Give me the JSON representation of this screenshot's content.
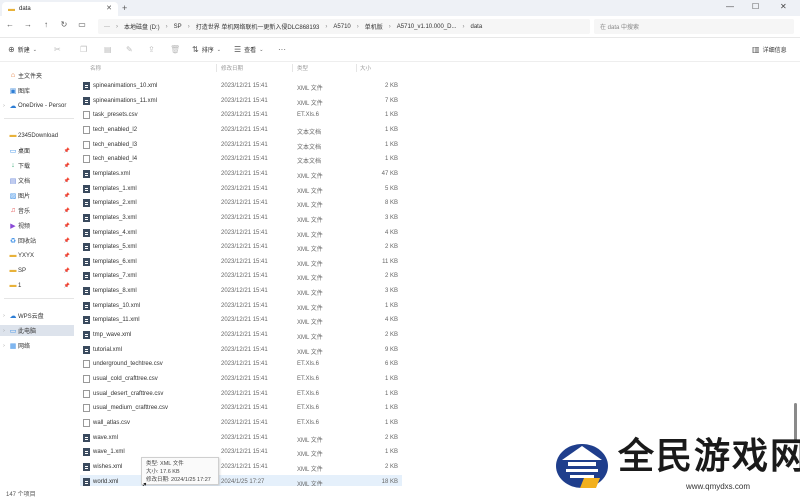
{
  "window": {
    "tab_title": "data",
    "minimize_glyph": "—",
    "maximize_glyph": "☐",
    "close_glyph": "✕"
  },
  "address": {
    "path": [
      "本地磁盘 (D:)",
      "SP",
      "打造世界 单机网络联机一更新入侵DLC868193",
      "A5710",
      "单机版",
      "A5710_v1.10.000_D...",
      "data"
    ],
    "search_placeholder": "在 data 中搜索"
  },
  "commands": {
    "new": "新建",
    "sort": "排序",
    "view": "查看",
    "details": "详细信息"
  },
  "sidebar": {
    "items": [
      {
        "label": "主文件夹",
        "icon": "home-icon",
        "glyph": "⌂",
        "color": "#e0702a"
      },
      {
        "label": "图库",
        "icon": "gallery-icon",
        "glyph": "▣",
        "color": "#2f7fd6"
      },
      {
        "label": "OneDrive - Persor",
        "icon": "cloud-icon",
        "glyph": "☁",
        "color": "#2f7fd6"
      },
      {
        "label": "2345Download",
        "icon": "folder-icon",
        "glyph": "▬",
        "color": "#e8b23a"
      },
      {
        "label": "桌面",
        "icon": "desktop-icon",
        "glyph": "▭",
        "color": "#3a8ee6"
      },
      {
        "label": "下载",
        "icon": "download-icon",
        "glyph": "↓",
        "color": "#2aa36b"
      },
      {
        "label": "文档",
        "icon": "documents-icon",
        "glyph": "▤",
        "color": "#5a7bd6"
      },
      {
        "label": "图片",
        "icon": "pictures-icon",
        "glyph": "▨",
        "color": "#3a8ee6"
      },
      {
        "label": "音乐",
        "icon": "music-icon",
        "glyph": "♫",
        "color": "#e04a4a"
      },
      {
        "label": "视频",
        "icon": "video-icon",
        "glyph": "▶",
        "color": "#8a4ad6"
      },
      {
        "label": "回收站",
        "icon": "recycle-bin-icon",
        "glyph": "♻",
        "color": "#3a8ee6"
      },
      {
        "label": "YXYX",
        "icon": "folder-icon",
        "glyph": "▬",
        "color": "#e8b23a"
      },
      {
        "label": "SP",
        "icon": "folder-icon",
        "glyph": "▬",
        "color": "#e8b23a"
      },
      {
        "label": "1",
        "icon": "folder-icon",
        "glyph": "▬",
        "color": "#e8b23a"
      },
      {
        "label": "WPS云盘",
        "icon": "cloud-icon",
        "glyph": "☁",
        "color": "#2f7fd6"
      },
      {
        "label": "此电脑",
        "icon": "computer-icon",
        "glyph": "▭",
        "color": "#3a8ee6"
      },
      {
        "label": "网络",
        "icon": "network-icon",
        "glyph": "▦",
        "color": "#3a8ee6"
      }
    ]
  },
  "columns": {
    "name": "名称",
    "date": "修改日期",
    "type": "类型",
    "size": "大小"
  },
  "files": [
    {
      "name": "spineanimations_10.xml",
      "date": "2023/12/21 15:41",
      "type": "XML 文件",
      "size": "2 KB",
      "kind": "xml"
    },
    {
      "name": "spineanimations_11.xml",
      "date": "2023/12/21 15:41",
      "type": "XML 文件",
      "size": "7 KB",
      "kind": "xml"
    },
    {
      "name": "task_presets.csv",
      "date": "2023/12/21 15:41",
      "type": "ET.Xls.6",
      "size": "1 KB",
      "kind": "doc"
    },
    {
      "name": "tech_enabled_l2",
      "date": "2023/12/21 15:41",
      "type": "文本文档",
      "size": "1 KB",
      "kind": "doc"
    },
    {
      "name": "tech_enabled_l3",
      "date": "2023/12/21 15:41",
      "type": "文本文档",
      "size": "1 KB",
      "kind": "doc"
    },
    {
      "name": "tech_enabled_l4",
      "date": "2023/12/21 15:41",
      "type": "文本文档",
      "size": "1 KB",
      "kind": "doc"
    },
    {
      "name": "templates.xml",
      "date": "2023/12/21 15:41",
      "type": "XML 文件",
      "size": "47 KB",
      "kind": "xml"
    },
    {
      "name": "templates_1.xml",
      "date": "2023/12/21 15:41",
      "type": "XML 文件",
      "size": "5 KB",
      "kind": "xml"
    },
    {
      "name": "templates_2.xml",
      "date": "2023/12/21 15:41",
      "type": "XML 文件",
      "size": "8 KB",
      "kind": "xml"
    },
    {
      "name": "templates_3.xml",
      "date": "2023/12/21 15:41",
      "type": "XML 文件",
      "size": "3 KB",
      "kind": "xml"
    },
    {
      "name": "templates_4.xml",
      "date": "2023/12/21 15:41",
      "type": "XML 文件",
      "size": "4 KB",
      "kind": "xml"
    },
    {
      "name": "templates_5.xml",
      "date": "2023/12/21 15:41",
      "type": "XML 文件",
      "size": "2 KB",
      "kind": "xml"
    },
    {
      "name": "templates_6.xml",
      "date": "2023/12/21 15:41",
      "type": "XML 文件",
      "size": "11 KB",
      "kind": "xml"
    },
    {
      "name": "templates_7.xml",
      "date": "2023/12/21 15:41",
      "type": "XML 文件",
      "size": "2 KB",
      "kind": "xml"
    },
    {
      "name": "templates_8.xml",
      "date": "2023/12/21 15:41",
      "type": "XML 文件",
      "size": "3 KB",
      "kind": "xml"
    },
    {
      "name": "templates_10.xml",
      "date": "2023/12/21 15:41",
      "type": "XML 文件",
      "size": "1 KB",
      "kind": "xml"
    },
    {
      "name": "templates_11.xml",
      "date": "2023/12/21 15:41",
      "type": "XML 文件",
      "size": "4 KB",
      "kind": "xml"
    },
    {
      "name": "tmp_wave.xml",
      "date": "2023/12/21 15:41",
      "type": "XML 文件",
      "size": "2 KB",
      "kind": "xml"
    },
    {
      "name": "tutorial.xml",
      "date": "2023/12/21 15:41",
      "type": "XML 文件",
      "size": "9 KB",
      "kind": "xml"
    },
    {
      "name": "underground_techtree.csv",
      "date": "2023/12/21 15:41",
      "type": "ET.Xls.6",
      "size": "6 KB",
      "kind": "doc"
    },
    {
      "name": "usual_cold_crafttree.csv",
      "date": "2023/12/21 15:41",
      "type": "ET.Xls.6",
      "size": "1 KB",
      "kind": "doc"
    },
    {
      "name": "usual_desert_crafttree.csv",
      "date": "2023/12/21 15:41",
      "type": "ET.Xls.6",
      "size": "1 KB",
      "kind": "doc"
    },
    {
      "name": "usual_medium_crafttree.csv",
      "date": "2023/12/21 15:41",
      "type": "ET.Xls.6",
      "size": "1 KB",
      "kind": "doc"
    },
    {
      "name": "wall_atlas.csv",
      "date": "2023/12/21 15:41",
      "type": "ET.Xls.6",
      "size": "1 KB",
      "kind": "doc"
    },
    {
      "name": "wave.xml",
      "date": "2023/12/21 15:41",
      "type": "XML 文件",
      "size": "2 KB",
      "kind": "xml"
    },
    {
      "name": "wave_1.xml",
      "date": "2023/12/21 15:41",
      "type": "XML 文件",
      "size": "1 KB",
      "kind": "xml"
    },
    {
      "name": "wishes.xml",
      "date": "2023/12/21 15:41",
      "type": "XML 文件",
      "size": "2 KB",
      "kind": "xml"
    },
    {
      "name": "world.xml",
      "date": "2024/1/25 17:27",
      "type": "XML 文件",
      "size": "18 KB",
      "kind": "xml"
    }
  ],
  "tooltip": {
    "type_line": "类型: XML 文件",
    "size_line": "大小: 17.6 KB",
    "date_line": "修改日期: 2024/1/25 17:27"
  },
  "status": {
    "item_count": "147 个项目"
  },
  "scroll": {
    "position_fraction": 0.85
  },
  "watermark": {
    "title": "全民游戏网",
    "url": "www.qmydxs.com"
  }
}
